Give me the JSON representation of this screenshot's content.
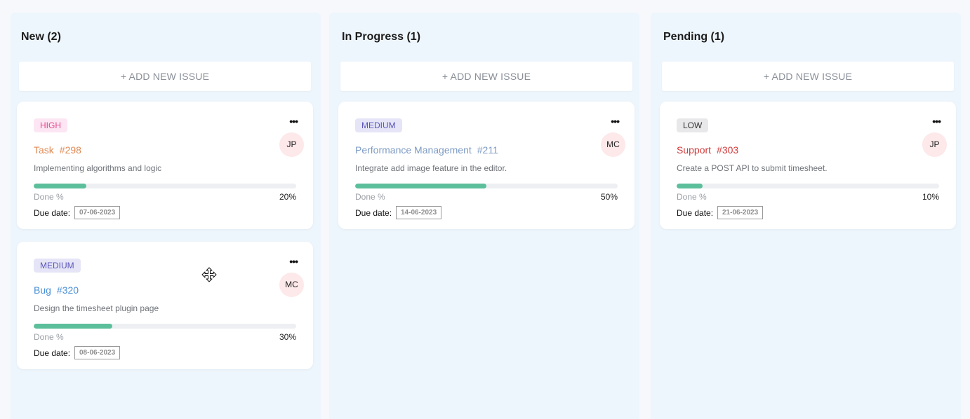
{
  "add_issue_label": "+ ADD NEW ISSUE",
  "done_label": "Done %",
  "due_label": "Due date:",
  "menu_icon": "more-horizontal-icon",
  "cursor_icon": "move-cursor-icon",
  "colors": {
    "progress": "#5cbf9b",
    "column_bg": "#eef6fd",
    "high_badge_bg": "#fde6f3",
    "high_badge_text": "#e14a8f",
    "medium_badge_bg": "#e5e5f7",
    "medium_badge_text": "#5b55b8",
    "low_badge_bg": "#e8e8ea",
    "task_type": "#e08a55",
    "bug_type": "#4a8fd6",
    "performance_type": "#7d9bc4",
    "support_type": "#d13b3b",
    "avatar_bg": "#fde8ea"
  },
  "columns": [
    {
      "title": "New (2)",
      "cards": [
        {
          "priority": "HIGH",
          "type": "Task",
          "number": "#298",
          "description": "Implementing algorithms and logic",
          "progress": 20,
          "progress_text": "20%",
          "due_date": "07-06-2023",
          "assignee": "JP"
        },
        {
          "priority": "MEDIUM",
          "type": "Bug",
          "number": "#320",
          "description": "Design the timesheet plugin page",
          "progress": 30,
          "progress_text": "30%",
          "due_date": "08-06-2023",
          "assignee": "MC"
        }
      ]
    },
    {
      "title": "In Progress (1)",
      "cards": [
        {
          "priority": "MEDIUM",
          "type": "Performance Management",
          "number": "#211",
          "description": "Integrate add image feature in the editor.",
          "progress": 50,
          "progress_text": "50%",
          "due_date": "14-06-2023",
          "assignee": "MC"
        }
      ]
    },
    {
      "title": "Pending (1)",
      "cards": [
        {
          "priority": "LOW",
          "type": "Support",
          "number": "#303",
          "description": "Create a POST API to submit timesheet.",
          "progress": 10,
          "progress_text": "10%",
          "due_date": "21-06-2023",
          "assignee": "JP"
        }
      ]
    }
  ]
}
